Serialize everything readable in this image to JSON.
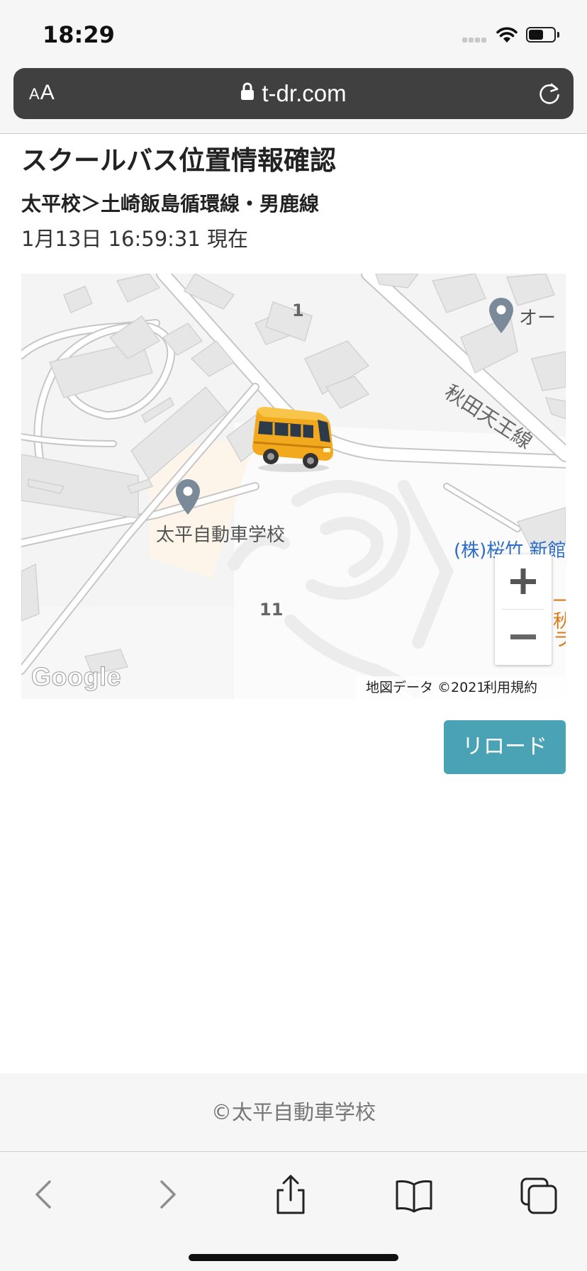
{
  "status_bar": {
    "time": "18:29"
  },
  "address_bar": {
    "text_size_label_small": "A",
    "text_size_label_large": "A",
    "url": "t-dr.com"
  },
  "page": {
    "title": "スクールバス位置情報確認",
    "route": "太平校＞土崎飯島循環線・男鹿線",
    "timestamp": "1月13日 16:59:31 現在"
  },
  "map": {
    "school_label": "太平自動車学校",
    "poi_top_right": "オー",
    "road_label": "秋田天王線",
    "poi_company": "(株)桜竹 新館",
    "poi_orange_1": "一",
    "poi_orange_2": "秋",
    "poi_orange_3": "ラ",
    "block_number_1": "1",
    "block_number_11": "11",
    "logo": "Google",
    "attribution": "地図データ ©2021",
    "terms": "利用規約",
    "zoom_in_symbol": "+",
    "zoom_out_symbol": "−",
    "marker_icon": "bus-icon",
    "colors": {
      "poi_blue": "#2a6cc8",
      "poi_orange": "#d77a16",
      "bus_body": "#f2a91e"
    }
  },
  "reload_button": {
    "label": "リロード",
    "color": "#4aa3b4"
  },
  "footer": {
    "copyright": "©太平自動車学校"
  },
  "toolbar": {
    "icons": [
      "back-icon",
      "forward-icon",
      "share-icon",
      "bookmarks-icon",
      "tabs-icon"
    ]
  }
}
